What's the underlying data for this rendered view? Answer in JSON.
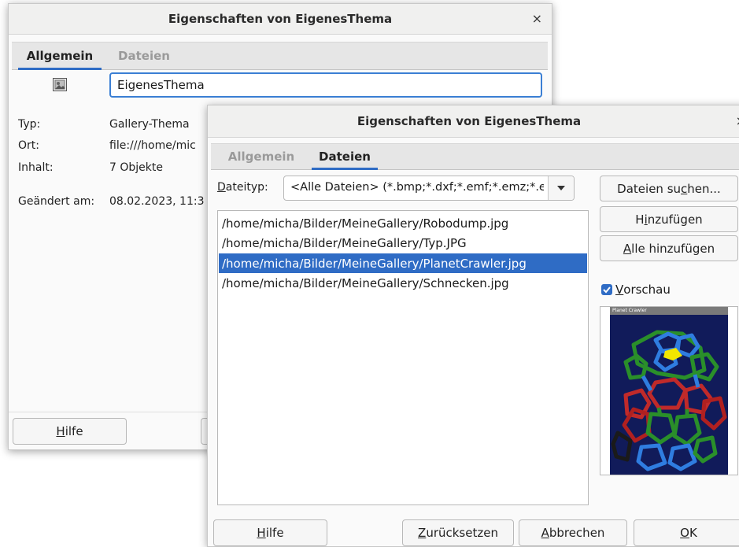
{
  "dialog_back": {
    "title": "Eigenschaften von EigenesThema",
    "close_glyph": "×",
    "tabs": [
      {
        "label": "Allgemein",
        "active": true
      },
      {
        "label": "Dateien",
        "active": false
      }
    ],
    "name_value": "EigenesThema",
    "fields": [
      {
        "label": "Typ:",
        "value": "Gallery-Thema"
      },
      {
        "label": "Ort:",
        "value": "file:///home/mic"
      },
      {
        "label": "Inhalt:",
        "value": "7 Objekte"
      },
      {
        "label": "Geändert am:",
        "value": "08.02.2023, 11:3"
      }
    ],
    "help_button": {
      "pre": "",
      "u": "H",
      "post": "ilfe"
    }
  },
  "dialog_front": {
    "title": "Eigenschaften von EigenesThema",
    "close_glyph": "×",
    "tabs": [
      {
        "label": "Allgemein",
        "active": false
      },
      {
        "label": "Dateien",
        "active": true
      }
    ],
    "filetype_label": {
      "u": "D",
      "post": "ateityp:"
    },
    "filetype_value": "<Alle Dateien> (*.bmp;*.dxf;*.emf;*.emz;*.e",
    "files": [
      {
        "path": "/home/micha/Bilder/MeineGallery/Robodump.jpg",
        "selected": false
      },
      {
        "path": "/home/micha/Bilder/MeineGallery/Typ.JPG",
        "selected": false
      },
      {
        "path": "/home/micha/Bilder/MeineGallery/PlanetCrawler.jpg",
        "selected": true
      },
      {
        "path": "/home/micha/Bilder/MeineGallery/Schnecken.jpg",
        "selected": false
      }
    ],
    "search_button": {
      "pre": "Dateien su",
      "u": "c",
      "post": "hen..."
    },
    "add_button": {
      "pre": "H",
      "u": "i",
      "post": "nzufügen"
    },
    "add_all_button": {
      "pre": "",
      "u": "A",
      "post": "lle hinzufügen"
    },
    "preview_checkbox": {
      "checked": true,
      "pre": "",
      "u": "V",
      "post": "orschau"
    },
    "preview_image_title": "Planet Crawler",
    "help_button": {
      "pre": "",
      "u": "H",
      "post": "ilfe"
    },
    "reset_button": {
      "pre": "",
      "u": "Z",
      "post": "urücksetzen"
    },
    "cancel_button": {
      "pre": "",
      "u": "A",
      "post": "bbrechen"
    },
    "ok_button": {
      "pre": "",
      "u": "O",
      "post": "K"
    },
    "colors": {
      "accent": "#2f6cc5",
      "selection": "#2f6cc5"
    }
  }
}
